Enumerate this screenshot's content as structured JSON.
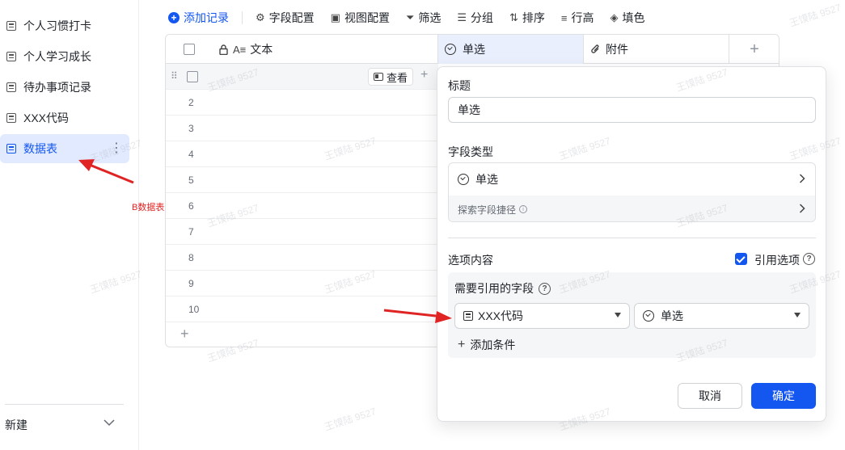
{
  "sidebar": {
    "items": [
      {
        "label": "个人习惯打卡",
        "active": false
      },
      {
        "label": "个人学习成长",
        "active": false
      },
      {
        "label": "待办事项记录",
        "active": false
      },
      {
        "label": "XXX代码",
        "active": false
      },
      {
        "label": "数据表",
        "active": true
      }
    ],
    "more_icon": "⋮",
    "new_label": "新建"
  },
  "annotation": {
    "label": "B数据表",
    "color": "#e02424"
  },
  "toolbar": {
    "add_record": "添加记录",
    "field_config": "字段配置",
    "view_config": "视图配置",
    "filter": "筛选",
    "group": "分组",
    "sort": "排序",
    "row_height": "行高",
    "fill_color": "填色"
  },
  "grid": {
    "columns": {
      "text": "文本",
      "single_select": "单选",
      "attachment": "附件"
    },
    "view_button": "查看",
    "rows": [
      "2",
      "3",
      "4",
      "5",
      "6",
      "7",
      "8",
      "9",
      "10"
    ]
  },
  "panel": {
    "title_label": "标题",
    "title_value": "单选",
    "field_type_label": "字段类型",
    "field_type_value": "单选",
    "explore_shortcut": "探索字段捷径",
    "options_label": "选项内容",
    "reference_option_label": "引用选项",
    "reference_option_checked": true,
    "required_field_label": "需要引用的字段",
    "ref_table": "XXX代码",
    "ref_field": "单选",
    "add_condition": "添加条件",
    "cancel": "取消",
    "confirm": "确定"
  },
  "watermark": "王馍陆 9527",
  "colors": {
    "accent": "#1456f0",
    "annotation": "#e02424",
    "selected_bg": "#e1eaff"
  }
}
